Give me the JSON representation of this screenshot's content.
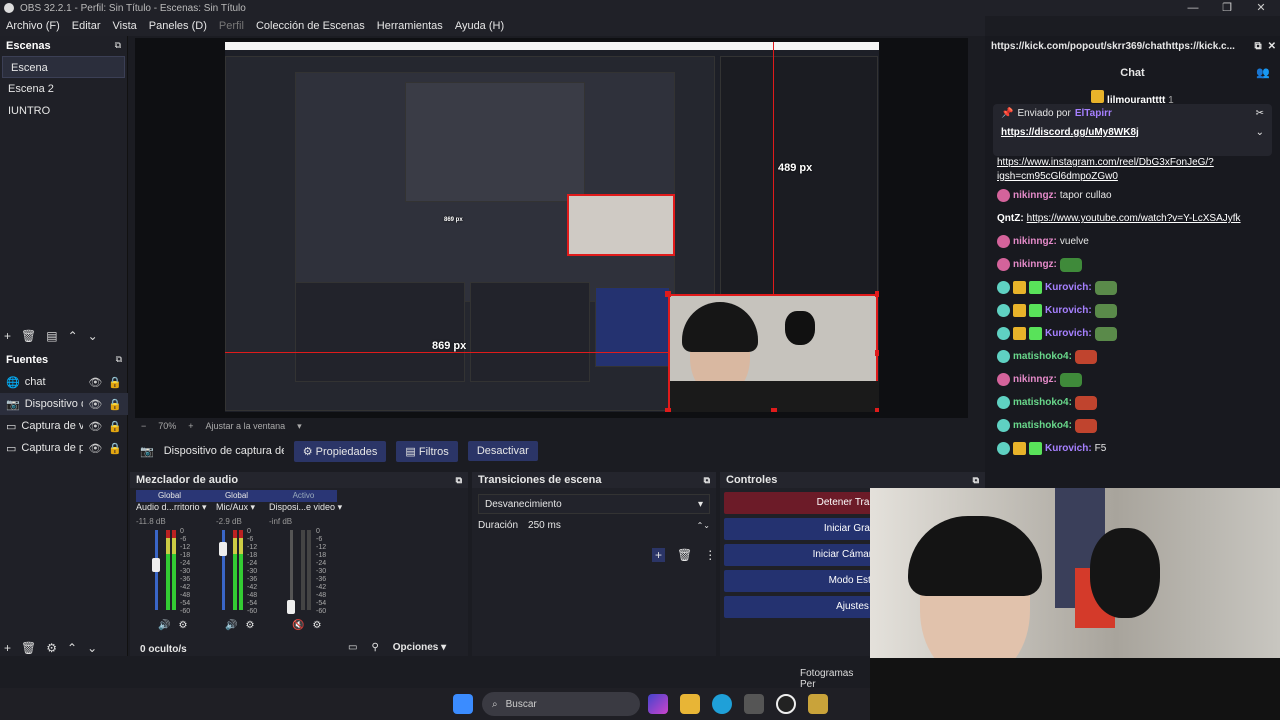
{
  "window": {
    "title": "OBS 32.2.1 - Perfil: Sin Título - Escenas: Sin Título",
    "controls": [
      "—",
      "❐",
      "✕"
    ]
  },
  "menu": [
    "Archivo (F)",
    "Editar",
    "Vista",
    "Paneles (D)",
    "Perfil",
    "Colección de Escenas",
    "Herramientas",
    "Ayuda (H)"
  ],
  "scenes": {
    "title": "Escenas",
    "items": [
      "Escena",
      "Escena 2",
      "IUNTRO"
    ]
  },
  "sources": {
    "title": "Fuentes",
    "items": [
      "chat",
      "Dispositivo de",
      "Captura de ve",
      "Captura de pa"
    ]
  },
  "preview": {
    "measure_h": "489 px",
    "measure_w": "869 px",
    "nested_measure": "869 px",
    "zoom": "70%",
    "fit_label": "Ajustar a la ventana"
  },
  "context_bar": {
    "source": "Dispositivo de captura de v",
    "properties": "Propiedades",
    "filters": "Filtros",
    "deactivate": "Desactivar"
  },
  "mixer": {
    "title": "Mezclador de audio",
    "header": [
      "Global",
      "Global",
      "Activo"
    ],
    "channels": [
      {
        "name": "Audio d...rritorio",
        "db": "-11.8 dB"
      },
      {
        "name": "Mic/Aux",
        "db": "-2.9 dB"
      },
      {
        "name": "Disposi...e video",
        "db": "-inf dB"
      }
    ],
    "scale": [
      "0",
      "-6",
      "-12",
      "-18",
      "-24",
      "-30",
      "-36",
      "-42",
      "-48",
      "-54",
      "-60"
    ],
    "hidden": "0 oculto/s",
    "options": "Opciones"
  },
  "transitions": {
    "title": "Transiciones de escena",
    "selected": "Desvanecimiento",
    "duration_label": "Duración",
    "duration_value": "250 ms"
  },
  "controls": {
    "title": "Controles",
    "buttons": [
      "Detener Transm",
      "Iniciar Graba",
      "Iniciar Cámara Vir",
      "Modo Estu",
      "Ajustes"
    ]
  },
  "status": {
    "fps": "Fotogramas Per"
  },
  "chat": {
    "url": "https://kick.com/popout/skrr369/chathttps://kick.c...",
    "title": "Chat",
    "top_user": "lilmourantttt",
    "top_count": "1",
    "pinned_by_label": "Enviado por",
    "pinned_by_user": "ElTapirr",
    "pinned_link": "https://discord.gg/uMy8WK8j",
    "link_cont": "https://www.instagram.com/reel/DbG3xFonJeG/?",
    "link_cont2": "igsh=cm95cGl6dmpoZGw0",
    "messages": [
      {
        "user": "nikinngz",
        "text": "tapor cullao",
        "color": "pink",
        "badge": "pink"
      },
      {
        "user": "QntZ",
        "text": "https://www.youtube.com/watch?v=Y-LcXSAJyfk",
        "color": "white",
        "badge": "none",
        "link": true
      },
      {
        "user": "nikinngz",
        "text": "vuelve",
        "color": "pink",
        "badge": "pink"
      },
      {
        "user": "nikinngz",
        "text": "",
        "color": "pink",
        "badge": "pink",
        "emote": "#3f8a3a"
      },
      {
        "user": "Kurovich",
        "text": "",
        "color": "purple",
        "badge": "multi",
        "emote": "#5a8a4a"
      },
      {
        "user": "Kurovich",
        "text": "",
        "color": "purple",
        "badge": "multi",
        "emote": "#5a8a4a"
      },
      {
        "user": "Kurovich",
        "text": "",
        "color": "purple",
        "badge": "multi",
        "emote": "#5a8a4a"
      },
      {
        "user": "matishoko4",
        "text": "",
        "color": "green",
        "badge": "green",
        "emote": "#c0442e"
      },
      {
        "user": "nikinngz",
        "text": "",
        "color": "pink",
        "badge": "pink",
        "emote": "#3f8a3a"
      },
      {
        "user": "matishoko4",
        "text": "",
        "color": "green",
        "badge": "green",
        "emote": "#c0442e"
      },
      {
        "user": "matishoko4",
        "text": "",
        "color": "green",
        "badge": "green",
        "emote": "#c0442e"
      },
      {
        "user": "Kurovich",
        "text": "F5",
        "color": "purple",
        "badge": "multi"
      }
    ]
  },
  "taskbar": {
    "search": "Buscar"
  },
  "colors": {
    "accent": "#2b3567",
    "recording_red": "#e01b1b",
    "stop_red": "#6c1b28"
  }
}
